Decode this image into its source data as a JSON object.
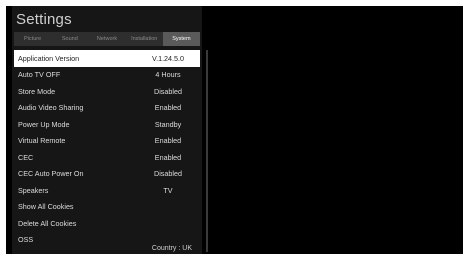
{
  "header": {
    "title": "Settings"
  },
  "tabs": [
    {
      "label": "Picture"
    },
    {
      "label": "Sound"
    },
    {
      "label": "Network"
    },
    {
      "label": "Installation"
    },
    {
      "label": "System"
    }
  ],
  "menu": [
    {
      "label": "Application Version",
      "value": "V.1.24.5.0"
    },
    {
      "label": "Auto TV OFF",
      "value": "4 Hours"
    },
    {
      "label": "Store Mode",
      "value": "Disabled"
    },
    {
      "label": "Audio Video Sharing",
      "value": "Enabled"
    },
    {
      "label": "Power Up Mode",
      "value": "Standby"
    },
    {
      "label": "Virtual Remote",
      "value": "Enabled"
    },
    {
      "label": "CEC",
      "value": "Enabled"
    },
    {
      "label": "CEC Auto Power On",
      "value": "Disabled"
    },
    {
      "label": "Speakers",
      "value": "TV"
    },
    {
      "label": "Show All Cookies",
      "value": ""
    },
    {
      "label": "Delete All Cookies",
      "value": ""
    },
    {
      "label": "OSS",
      "value": ""
    }
  ],
  "footer": {
    "country": "Country : UK"
  },
  "colors": {
    "panel": "#161616",
    "selected": "#ffffff",
    "background": "#000000"
  }
}
